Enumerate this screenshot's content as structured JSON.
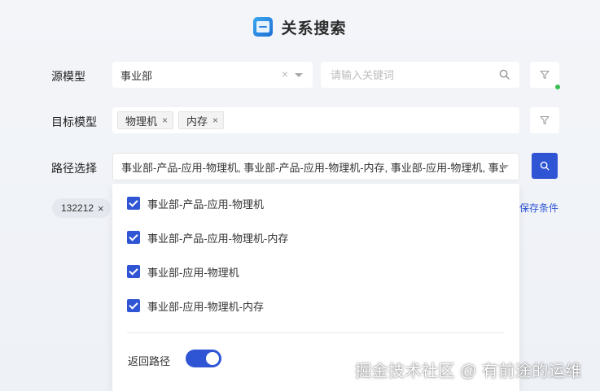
{
  "header": {
    "title": "关系搜索",
    "logo_icon": "panel-icon"
  },
  "source_model": {
    "label": "源模型",
    "value": "事业部",
    "clear_glyph": "×"
  },
  "keyword": {
    "placeholder": "请输入关键词"
  },
  "target_model": {
    "label": "目标模型",
    "tags": [
      {
        "text": "物理机",
        "close": "×"
      },
      {
        "text": "内存",
        "close": "×"
      }
    ]
  },
  "path": {
    "label": "路径选择",
    "value": "事业部-产品-应用-物理机, 事业部-产品-应用-物理机-内存, 事业部-应用-物理机, 事业部-应用-物理机-内存",
    "options": [
      {
        "label": "事业部-产品-应用-物理机",
        "checked": true
      },
      {
        "label": "事业部-产品-应用-物理机-内存",
        "checked": true
      },
      {
        "label": "事业部-应用-物理机",
        "checked": true
      },
      {
        "label": "事业部-应用-物理机-内存",
        "checked": true
      }
    ],
    "return_path_label": "返回路径",
    "return_path_on": true
  },
  "saved_chip": {
    "text": "132212",
    "close": "×"
  },
  "save_condition": "保存条件",
  "watermark": "掘金技术社区 @ 有前途的运维",
  "colors": {
    "primary": "#2f55d4",
    "status_dot": "#3bbf52"
  }
}
